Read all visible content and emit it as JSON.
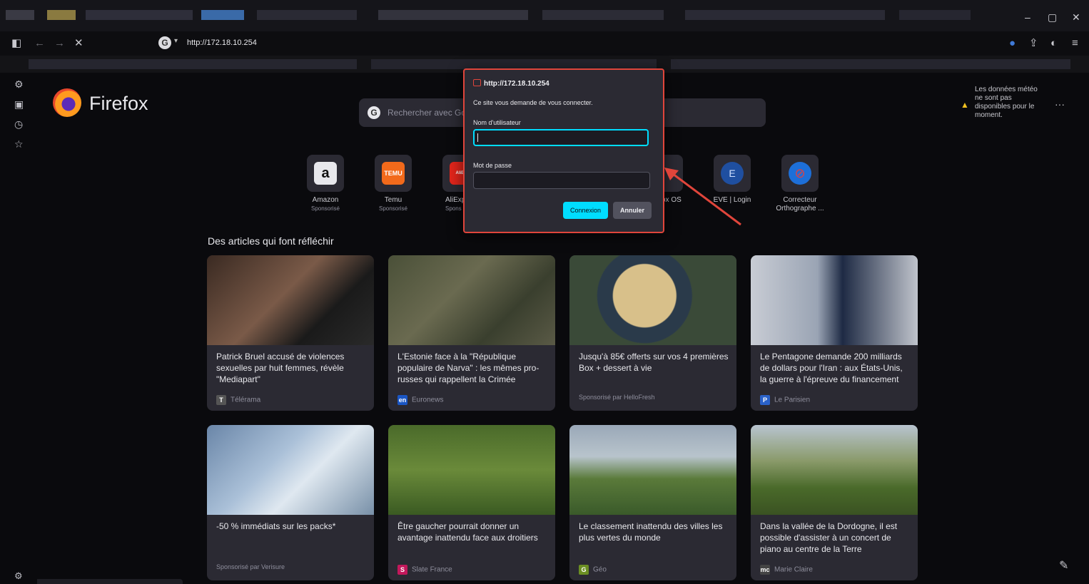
{
  "browser": {
    "url": "http://172.18.10.254",
    "window_controls": [
      "–",
      "▢",
      "✕"
    ]
  },
  "firefox": {
    "brand": "Firefox",
    "search_placeholder": "Rechercher avec Google ou saisir une adresse"
  },
  "weather": {
    "message": "Les données météo ne sont pas disponibles pour le moment."
  },
  "shortcuts": [
    {
      "label": "Amazon",
      "sub": "Sponsorisé",
      "glyph": "a",
      "bg": "#e8e8ec",
      "fg": "#111"
    },
    {
      "label": "Temu",
      "sub": "Sponsorisé",
      "glyph": "TEMU",
      "bg": "#f26a1b",
      "fg": "#fff"
    },
    {
      "label": "AliExp",
      "sub": "Spons",
      "glyph": "AliEx",
      "bg": "#e1251b",
      "fg": "#fff"
    },
    {
      "label": "ox OS",
      "sub": "",
      "glyph": "",
      "bg": "#2b2a33",
      "fg": "#fff"
    },
    {
      "label": "EVE | Login",
      "sub": "",
      "glyph": "E",
      "bg": "#1f4fa0",
      "fg": "#cfe0ff"
    },
    {
      "label": "Correcteur Orthographe ...",
      "sub": "",
      "glyph": "⊘",
      "bg": "#1d6fd8",
      "fg": "#e04040"
    }
  ],
  "articles_heading": "Des articles qui font réfléchir",
  "articles": [
    {
      "title": "Patrick Bruel accusé de violences sexuelles par huit femmes, révèle \"Mediapart\"",
      "source": "Télérama",
      "src_glyph": "T",
      "src_color": "#555"
    },
    {
      "title": "L'Estonie face à la \"République populaire de Narva\" : les mêmes pro-russes qui rappellent la Crimée",
      "source": "Euronews",
      "src_glyph": "en",
      "src_color": "#1a56c4"
    },
    {
      "title": "Jusqu'à 85€ offerts sur vos 4 premières Box + dessert à vie",
      "source": "Sponsorisé par HelloFresh",
      "src_glyph": "",
      "src_color": ""
    },
    {
      "title": "Le Pentagone demande 200 milliards de dollars pour l'Iran : aux États-Unis, la guerre à l'épreuve du financement",
      "source": "Le Parisien",
      "src_glyph": "P",
      "src_color": "#2a62c9"
    },
    {
      "title": "-50 % immédiats sur les packs*",
      "source": "Sponsorisé par Verisure",
      "src_glyph": "",
      "src_color": ""
    },
    {
      "title": "Être gaucher pourrait donner un avantage inattendu face aux droitiers",
      "source": "Slate France",
      "src_glyph": "S",
      "src_color": "#c2185b"
    },
    {
      "title": "Le classement inattendu des villes les plus vertes du monde",
      "source": "Géo",
      "src_glyph": "G",
      "src_color": "#6b8e23"
    },
    {
      "title": "Dans la vallée de la Dordogne, il est possible d'assister à un concert de piano au centre de la Terre",
      "source": "Marie Claire",
      "src_glyph": "mc",
      "src_color": "#444"
    }
  ],
  "dialog": {
    "host": "http://172.18.10.254",
    "message": "Ce site vous demande de vous connecter.",
    "username_label": "Nom d'utilisateur",
    "username_value": "",
    "password_label": "Mot de passe",
    "password_value": "",
    "ok_label": "Connexion",
    "cancel_label": "Annuler"
  },
  "colors": {
    "accent": "#00ddff",
    "highlight": "#e0453b",
    "surface": "#2b2a33",
    "background": "#0a0a0d"
  }
}
